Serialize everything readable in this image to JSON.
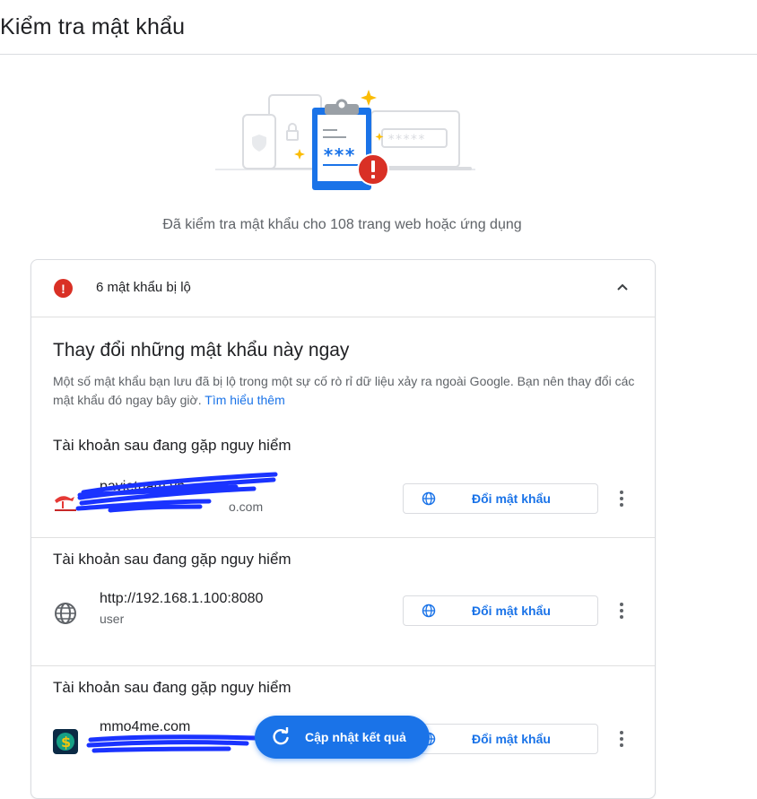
{
  "page": {
    "title": "Kiểm tra mật khẩu"
  },
  "summary": {
    "checked_text": "Đã kiểm tra mật khẩu cho 108 trang web hoặc ứng dụng"
  },
  "hero": {
    "masked_password": "***",
    "masked_field": "*****"
  },
  "card": {
    "header_label": "6 mật khẩu bị lộ",
    "section_title": "Thay đổi những mật khẩu này ngay",
    "description": "Một số mật khẩu bạn lưu đã bị lộ trong một sự cố rò rỉ dữ liệu xảy ra ngoài Google. Bạn nên thay đổi các mật khẩu đó ngay bây giờ.",
    "learn_more": "Tìm hiểu thêm",
    "entries": [
      {
        "title": "Tài khoản sau đang gặp nguy hiểm",
        "site": "pavietnam.vn",
        "username_suffix": "o.com",
        "icon": "pavietnam-logo-icon",
        "button": "Đổi mật khẩu"
      },
      {
        "title": "Tài khoản sau đang gặp nguy hiểm",
        "site": "http://192.168.1.100:8080",
        "username": "user",
        "icon": "globe-icon",
        "button": "Đổi mật khẩu"
      },
      {
        "title": "Tài khoản sau đang gặp nguy hiểm",
        "site": "mmo4me.com",
        "icon": "mmo4me-logo-icon",
        "button": "Đổi mật khẩu"
      }
    ]
  },
  "fab": {
    "label": "Cập nhật kết quả",
    "icon": "refresh-icon"
  },
  "colors": {
    "accent": "#1a73e8",
    "danger": "#d93025",
    "star": "#fbbc04"
  }
}
